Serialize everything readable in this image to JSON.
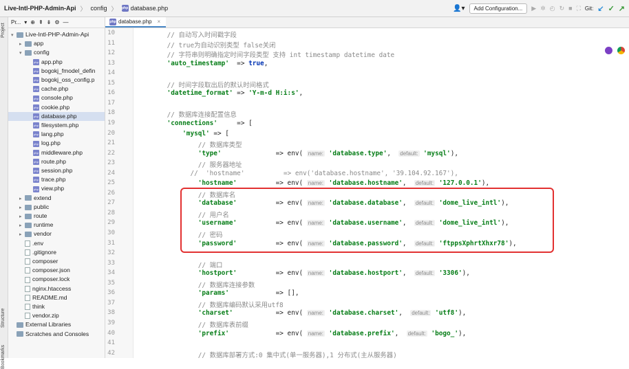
{
  "breadcrumb": {
    "project": "Live-Intl-PHP-Admin-Api",
    "folder": "config",
    "file": "database.php"
  },
  "toolbar": {
    "add_config": "Add Configuration...",
    "git": "Git:"
  },
  "sidebar": {
    "project_label": "Project",
    "structure_label": "Structure",
    "bookmarks_label": "Bookmarks"
  },
  "project_panel": {
    "title": "Pr..."
  },
  "tree": [
    {
      "label": "Live-Intl-PHP-Admin-Api",
      "depth": 0,
      "type": "folder",
      "open": true
    },
    {
      "label": "app",
      "depth": 1,
      "type": "folder",
      "open": false
    },
    {
      "label": "config",
      "depth": 1,
      "type": "folder",
      "open": true
    },
    {
      "label": "app.php",
      "depth": 2,
      "type": "php"
    },
    {
      "label": "bogokj_fmodel_defin",
      "depth": 2,
      "type": "php"
    },
    {
      "label": "bogokj_oss_config.p",
      "depth": 2,
      "type": "php"
    },
    {
      "label": "cache.php",
      "depth": 2,
      "type": "php"
    },
    {
      "label": "console.php",
      "depth": 2,
      "type": "php"
    },
    {
      "label": "cookie.php",
      "depth": 2,
      "type": "php"
    },
    {
      "label": "database.php",
      "depth": 2,
      "type": "php",
      "selected": true
    },
    {
      "label": "filesystem.php",
      "depth": 2,
      "type": "php"
    },
    {
      "label": "lang.php",
      "depth": 2,
      "type": "php"
    },
    {
      "label": "log.php",
      "depth": 2,
      "type": "php"
    },
    {
      "label": "middleware.php",
      "depth": 2,
      "type": "php"
    },
    {
      "label": "route.php",
      "depth": 2,
      "type": "php"
    },
    {
      "label": "session.php",
      "depth": 2,
      "type": "php"
    },
    {
      "label": "trace.php",
      "depth": 2,
      "type": "php"
    },
    {
      "label": "view.php",
      "depth": 2,
      "type": "php"
    },
    {
      "label": "extend",
      "depth": 1,
      "type": "folder",
      "open": false
    },
    {
      "label": "public",
      "depth": 1,
      "type": "folder",
      "open": false
    },
    {
      "label": "route",
      "depth": 1,
      "type": "folder",
      "open": false
    },
    {
      "label": "runtime",
      "depth": 1,
      "type": "folder",
      "open": false
    },
    {
      "label": "vendor",
      "depth": 1,
      "type": "folder",
      "open": false
    },
    {
      "label": ".env",
      "depth": 1,
      "type": "file"
    },
    {
      "label": ".gitignore",
      "depth": 1,
      "type": "file"
    },
    {
      "label": "composer",
      "depth": 1,
      "type": "file"
    },
    {
      "label": "composer.json",
      "depth": 1,
      "type": "file"
    },
    {
      "label": "composer.lock",
      "depth": 1,
      "type": "file"
    },
    {
      "label": "nginx.htaccess",
      "depth": 1,
      "type": "file"
    },
    {
      "label": "README.md",
      "depth": 1,
      "type": "file"
    },
    {
      "label": "think",
      "depth": 1,
      "type": "file"
    },
    {
      "label": "vendor.zip",
      "depth": 1,
      "type": "file"
    },
    {
      "label": "External Libraries",
      "depth": 0,
      "type": "lib"
    },
    {
      "label": "Scratches and Consoles",
      "depth": 0,
      "type": "lib"
    }
  ],
  "tab": {
    "label": "database.php",
    "close": "×"
  },
  "lines": [
    {
      "n": "10",
      "t": [
        [
          "c",
          "    // 自动写入时间戳字段"
        ]
      ]
    },
    {
      "n": "11",
      "t": [
        [
          "c",
          "    // true为自动识别类型 false关闭"
        ]
      ]
    },
    {
      "n": "12",
      "t": [
        [
          "c",
          "    // 字符串则明确指定时间字段类型 支持 int timestamp datetime date"
        ]
      ]
    },
    {
      "n": "13",
      "t": [
        [
          "s",
          "    'auto_timestamp'"
        ],
        [
          "p",
          "  => "
        ],
        [
          "k",
          "true"
        ],
        [
          "p",
          ","
        ]
      ]
    },
    {
      "n": "14",
      "t": []
    },
    {
      "n": "15",
      "t": [
        [
          "c",
          "    // 时间字段取出后的默认时间格式"
        ]
      ]
    },
    {
      "n": "16",
      "t": [
        [
          "s",
          "    'datetime_format'"
        ],
        [
          "p",
          " => "
        ],
        [
          "s",
          "'Y-m-d H:i:s'"
        ],
        [
          "p",
          ","
        ]
      ]
    },
    {
      "n": "17",
      "t": []
    },
    {
      "n": "18",
      "t": [
        [
          "c",
          "    // 数据库连接配置信息"
        ]
      ]
    },
    {
      "n": "19",
      "t": [
        [
          "s",
          "    'connections'"
        ],
        [
          "p",
          "     => ["
        ]
      ]
    },
    {
      "n": "20",
      "t": [
        [
          "s",
          "        'mysql'"
        ],
        [
          "p",
          " => ["
        ]
      ]
    },
    {
      "n": "21",
      "t": [
        [
          "c",
          "            // 数据库类型"
        ]
      ]
    },
    {
      "n": "22",
      "t": [
        [
          "s",
          "            'type'"
        ],
        [
          "p",
          "              => env( "
        ],
        [
          "h",
          "name:"
        ],
        [
          "s",
          " 'database.type'"
        ],
        [
          "p",
          ",  "
        ],
        [
          "h",
          "default:"
        ],
        [
          "s",
          " 'mysql'"
        ],
        [
          "p",
          "),"
        ]
      ]
    },
    {
      "n": "23",
      "t": [
        [
          "c",
          "            // 服务器地址"
        ]
      ]
    },
    {
      "n": "24",
      "t": [
        [
          "c",
          "          //  'hostname'          => env('database.hostname', '39.104.92.167'),"
        ]
      ]
    },
    {
      "n": "25",
      "t": [
        [
          "s",
          "            'hostname'"
        ],
        [
          "p",
          "          => env( "
        ],
        [
          "h",
          "name:"
        ],
        [
          "s",
          " 'database.hostname'"
        ],
        [
          "p",
          ",  "
        ],
        [
          "h",
          "default:"
        ],
        [
          "s",
          " '127.0.0.1'"
        ],
        [
          "p",
          "),"
        ]
      ]
    },
    {
      "n": "26",
      "t": [
        [
          "c",
          "            // 数据库名"
        ]
      ]
    },
    {
      "n": "27",
      "t": [
        [
          "s",
          "            'database'"
        ],
        [
          "p",
          "          => env( "
        ],
        [
          "h",
          "name:"
        ],
        [
          "s",
          " 'database.database'"
        ],
        [
          "p",
          ",  "
        ],
        [
          "h",
          "default:"
        ],
        [
          "s",
          " 'dome_live_intl'"
        ],
        [
          "p",
          "),"
        ]
      ]
    },
    {
      "n": "28",
      "t": [
        [
          "c",
          "            // 用户名"
        ]
      ]
    },
    {
      "n": "29",
      "t": [
        [
          "s",
          "            'username'"
        ],
        [
          "p",
          "          => env( "
        ],
        [
          "h",
          "name:"
        ],
        [
          "s",
          " 'database.username'"
        ],
        [
          "p",
          ",  "
        ],
        [
          "h",
          "default:"
        ],
        [
          "s",
          " 'dome_live_intl'"
        ],
        [
          "p",
          "),"
        ]
      ]
    },
    {
      "n": "30",
      "t": [
        [
          "c",
          "            // 密码"
        ]
      ]
    },
    {
      "n": "31",
      "t": [
        [
          "s",
          "            'password'"
        ],
        [
          "p",
          "          => env( "
        ],
        [
          "h",
          "name:"
        ],
        [
          "s",
          " 'database.password'"
        ],
        [
          "p",
          ",  "
        ],
        [
          "h",
          "default:"
        ],
        [
          "s",
          " 'ftppsXphrtXhxr78'"
        ],
        [
          "p",
          "),"
        ]
      ]
    },
    {
      "n": "32",
      "t": []
    },
    {
      "n": "33",
      "t": [
        [
          "c",
          "            // 端口"
        ]
      ]
    },
    {
      "n": "34",
      "t": [
        [
          "s",
          "            'hostport'"
        ],
        [
          "p",
          "          => env( "
        ],
        [
          "h",
          "name:"
        ],
        [
          "s",
          " 'database.hostport'"
        ],
        [
          "p",
          ",  "
        ],
        [
          "h",
          "default:"
        ],
        [
          "s",
          " '3306'"
        ],
        [
          "p",
          "),"
        ]
      ]
    },
    {
      "n": "35",
      "t": [
        [
          "c",
          "            // 数据库连接参数"
        ]
      ]
    },
    {
      "n": "36",
      "t": [
        [
          "s",
          "            'params'"
        ],
        [
          "p",
          "            => [],"
        ]
      ]
    },
    {
      "n": "37",
      "t": [
        [
          "c",
          "            // 数据库编码默认采用utf8"
        ]
      ]
    },
    {
      "n": "38",
      "t": [
        [
          "s",
          "            'charset'"
        ],
        [
          "p",
          "           => env( "
        ],
        [
          "h",
          "name:"
        ],
        [
          "s",
          " 'database.charset'"
        ],
        [
          "p",
          ",  "
        ],
        [
          "h",
          "default:"
        ],
        [
          "s",
          " 'utf8'"
        ],
        [
          "p",
          "),"
        ]
      ]
    },
    {
      "n": "39",
      "t": [
        [
          "c",
          "            // 数据库表前缀"
        ]
      ]
    },
    {
      "n": "40",
      "t": [
        [
          "s",
          "            'prefix'"
        ],
        [
          "p",
          "            => env( "
        ],
        [
          "h",
          "name:"
        ],
        [
          "s",
          " 'database.prefix'"
        ],
        [
          "p",
          ",  "
        ],
        [
          "h",
          "default:"
        ],
        [
          "s",
          " 'bogo_'"
        ],
        [
          "p",
          "),"
        ]
      ]
    },
    {
      "n": "41",
      "t": []
    },
    {
      "n": "42",
      "t": [
        [
          "c",
          "            // 数据库部署方式:0 集中式(单一服务器),1 分布式(主从服务器)"
        ]
      ]
    }
  ]
}
